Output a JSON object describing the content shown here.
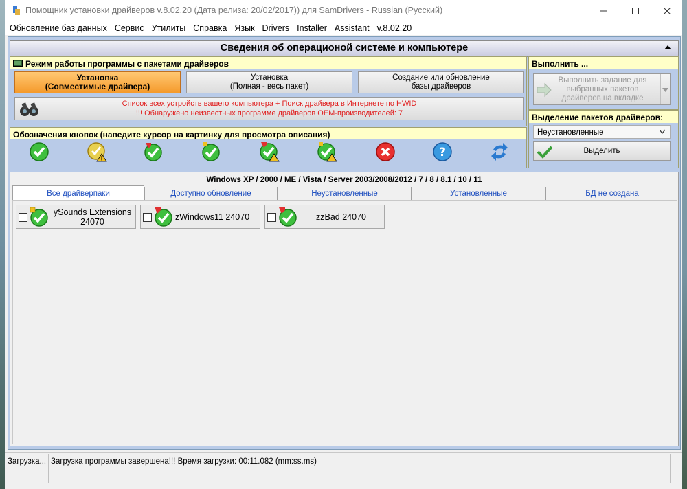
{
  "window": {
    "title": "Помощник установки драйверов v.8.02.20 (Дата релиза: 20/02/2017)) для SamDrivers - Russian (Русский)"
  },
  "menu": [
    "Обновление баз данных",
    "Сервис",
    "Утилиты",
    "Справка",
    "Язык",
    "Drivers",
    "Installer",
    "Assistant",
    "v.8.02.20"
  ],
  "header": {
    "title": "Сведения об операционой системе и компьютере"
  },
  "mode_panel": {
    "title": "Режим работы программы с пакетами драйверов",
    "buttons": [
      {
        "line1": "Установка",
        "line2": "(Совместимые драйвера)"
      },
      {
        "line1": "Установка",
        "line2": "(Полная - весь пакет)"
      },
      {
        "line1": "Создание или обновление",
        "line2": "базы драйверов"
      }
    ],
    "warning_line1": "Список всех устройств вашего компьютера + Поиск драйвера в Интернете по HWID",
    "warning_line2": "!!! Обнаружено неизвестных программе драйверов OEM-производителей: 7"
  },
  "legend_panel": {
    "title": "Обозначения кнопок (наведите курсор на картинку для просмотра описания)"
  },
  "execute_panel": {
    "title": "Выполнить ...",
    "button_line1": "Выполнить задание для",
    "button_line2": "выбранных пакетов",
    "button_line3": "драйверов на вкладке"
  },
  "select_panel": {
    "title": "Выделение пакетов драйверов:",
    "selected": "Неустановленные",
    "button": "Выделить"
  },
  "os_line": "Windows XP / 2000 / ME / Vista / Server 2003/2008/2012 / 7 / 8 / 8.1 / 10 / 11",
  "tabs": [
    "Все драйверпаки",
    "Доступно обновление",
    "Неустановленные",
    "Установленные",
    "БД не создана"
  ],
  "packages": [
    {
      "line1": "ySounds Extensions",
      "line2": "24070"
    },
    {
      "line1": "zWindows11 24070",
      "line2": ""
    },
    {
      "line1": "zzBad 24070",
      "line2": ""
    }
  ],
  "status": {
    "left": "Загрузка...",
    "message": "Загрузка программы завершена!!! Время загрузки: 00:11.082 (mm:ss.ms)"
  },
  "colors": {
    "active_mode": "#f59a2b",
    "panel_yellow": "#ffffc8",
    "panel_blue": "#b9cbe8",
    "warning_text": "#e02020",
    "tab_text": "#2050c0"
  }
}
